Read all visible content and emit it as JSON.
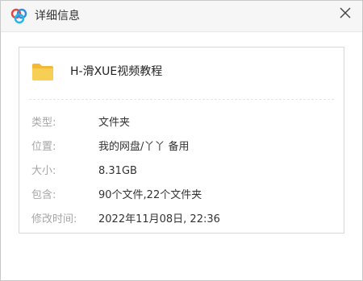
{
  "window": {
    "title": "详细信息",
    "logo_icon": "baidu-netdisk-cloud-icon",
    "close_icon": "close-x-icon"
  },
  "file": {
    "icon": "folder-icon",
    "icon_color": "#f5c343",
    "name": "H-滑XUE视频教程"
  },
  "details": [
    {
      "label": "类型:",
      "value": "文件夹"
    },
    {
      "label": "位置:",
      "value": "我的网盘/丫丫 备用"
    },
    {
      "label": "大小:",
      "value": "8.31GB"
    },
    {
      "label": "包含:",
      "value": "90个文件,22个文件夹"
    },
    {
      "label": "修改时间:",
      "value": "2022年11月08日, 22:36"
    }
  ]
}
